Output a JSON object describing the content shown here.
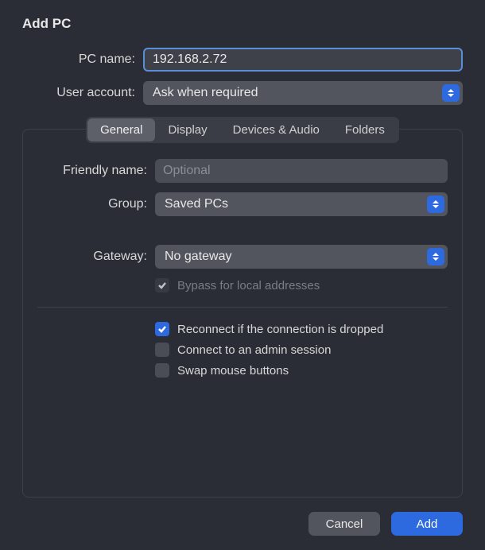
{
  "title": "Add PC",
  "top": {
    "pc_name_label": "PC name:",
    "pc_name_value": "192.168.2.72",
    "user_account_label": "User account:",
    "user_account_value": "Ask when required"
  },
  "tabs": {
    "general": "General",
    "display": "Display",
    "devices": "Devices & Audio",
    "folders": "Folders"
  },
  "general": {
    "friendly_name_label": "Friendly name:",
    "friendly_name_placeholder": "Optional",
    "group_label": "Group:",
    "group_value": "Saved PCs",
    "gateway_label": "Gateway:",
    "gateway_value": "No gateway",
    "bypass_label": "Bypass for local addresses",
    "reconnect_label": "Reconnect if the connection is dropped",
    "admin_label": "Connect to an admin session",
    "swap_label": "Swap mouse buttons"
  },
  "footer": {
    "cancel": "Cancel",
    "add": "Add"
  }
}
